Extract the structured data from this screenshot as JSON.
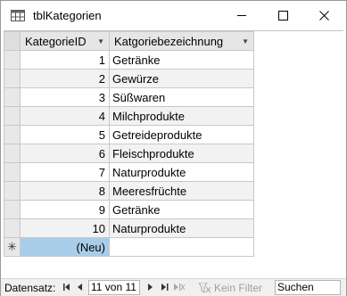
{
  "window": {
    "title": "tblKategorien"
  },
  "grid": {
    "columns": [
      "KategorieID",
      "Katgoriebezeichnung"
    ],
    "rows": [
      {
        "id": "1",
        "name": "Getränke"
      },
      {
        "id": "2",
        "name": "Gewürze"
      },
      {
        "id": "3",
        "name": "Süßwaren"
      },
      {
        "id": "4",
        "name": "Milchprodukte"
      },
      {
        "id": "5",
        "name": "Getreideprodukte"
      },
      {
        "id": "6",
        "name": "Fleischprodukte"
      },
      {
        "id": "7",
        "name": "Naturprodukte"
      },
      {
        "id": "8",
        "name": "Meeresfrüchte"
      },
      {
        "id": "9",
        "name": "Getränke"
      },
      {
        "id": "10",
        "name": "Naturprodukte"
      }
    ],
    "new_row_marker": "✳",
    "new_row_value": "(Neu)"
  },
  "navigation": {
    "label": "Datensatz:",
    "record": "11 von 11",
    "filter_label": "Kein Filter",
    "search_placeholder": "Suchen"
  },
  "colors": {
    "header_bg": "#e6e6e6",
    "new_row_bg": "#a8cde9",
    "alt_row_bg": "#f2f2f2"
  }
}
